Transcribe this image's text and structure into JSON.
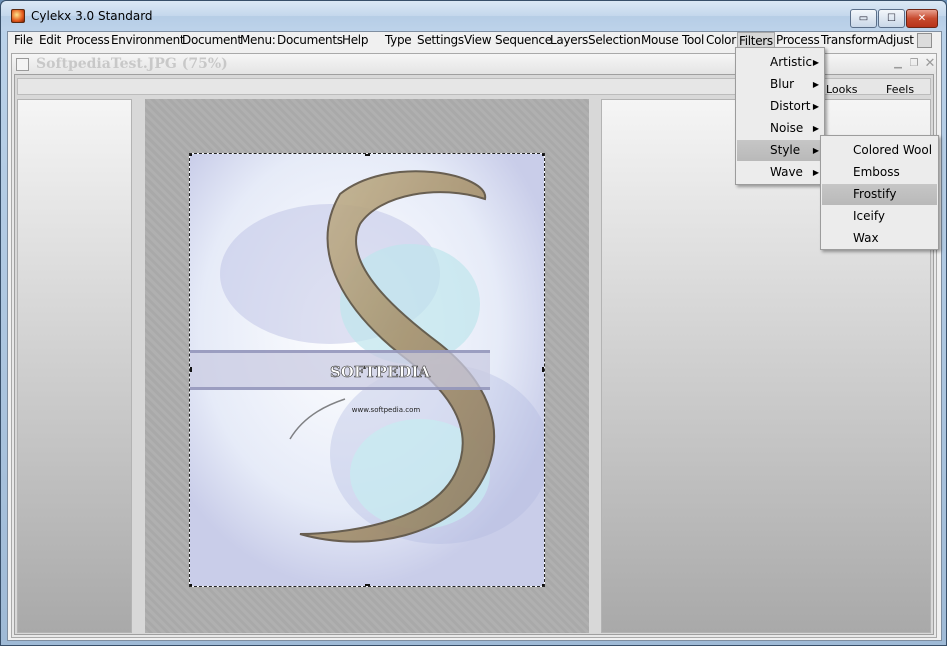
{
  "app": {
    "title": "Cylekx 3.0 Standard"
  },
  "window_controls": {
    "minimize": "▭",
    "maximize": "☐",
    "close": "✕"
  },
  "menubar": {
    "items": [
      "File",
      "Edit",
      "Process",
      "Environment",
      "Document",
      "Menu:",
      "Documents",
      "Help",
      "Type",
      "Settings",
      "View",
      "Sequence",
      "Layers",
      "Selection",
      "Mouse Tool",
      "Color",
      "Filters",
      "Process",
      "Transform",
      "Adjust"
    ],
    "active": "Filters"
  },
  "document": {
    "title": "SoftpediaTest.JPG (75%)",
    "ruler_labels": {
      "looks": "Looks",
      "feels": "Feels"
    },
    "image_text": {
      "brand": "SOFTPEDIA",
      "url": "www.softpedia.com"
    }
  },
  "filters_menu": {
    "items": [
      {
        "label": "Artistic",
        "submenu": true
      },
      {
        "label": "Blur",
        "submenu": true
      },
      {
        "label": "Distort",
        "submenu": true
      },
      {
        "label": "Noise",
        "submenu": true
      },
      {
        "label": "Style",
        "submenu": true,
        "selected": true
      },
      {
        "label": "Wave",
        "submenu": true
      }
    ]
  },
  "style_submenu": {
    "items": [
      {
        "label": "Colored Wool"
      },
      {
        "label": "Emboss"
      },
      {
        "label": "Frostify",
        "selected": true
      },
      {
        "label": "Iceify"
      },
      {
        "label": "Wax"
      }
    ]
  },
  "icons": {
    "app": "cylekx-app-icon",
    "submenu_arrow": "▶"
  },
  "colors": {
    "title_bar": "#c4d7ec",
    "close_button": "#c74a2e",
    "menu_highlight": "#c6c6c6"
  }
}
